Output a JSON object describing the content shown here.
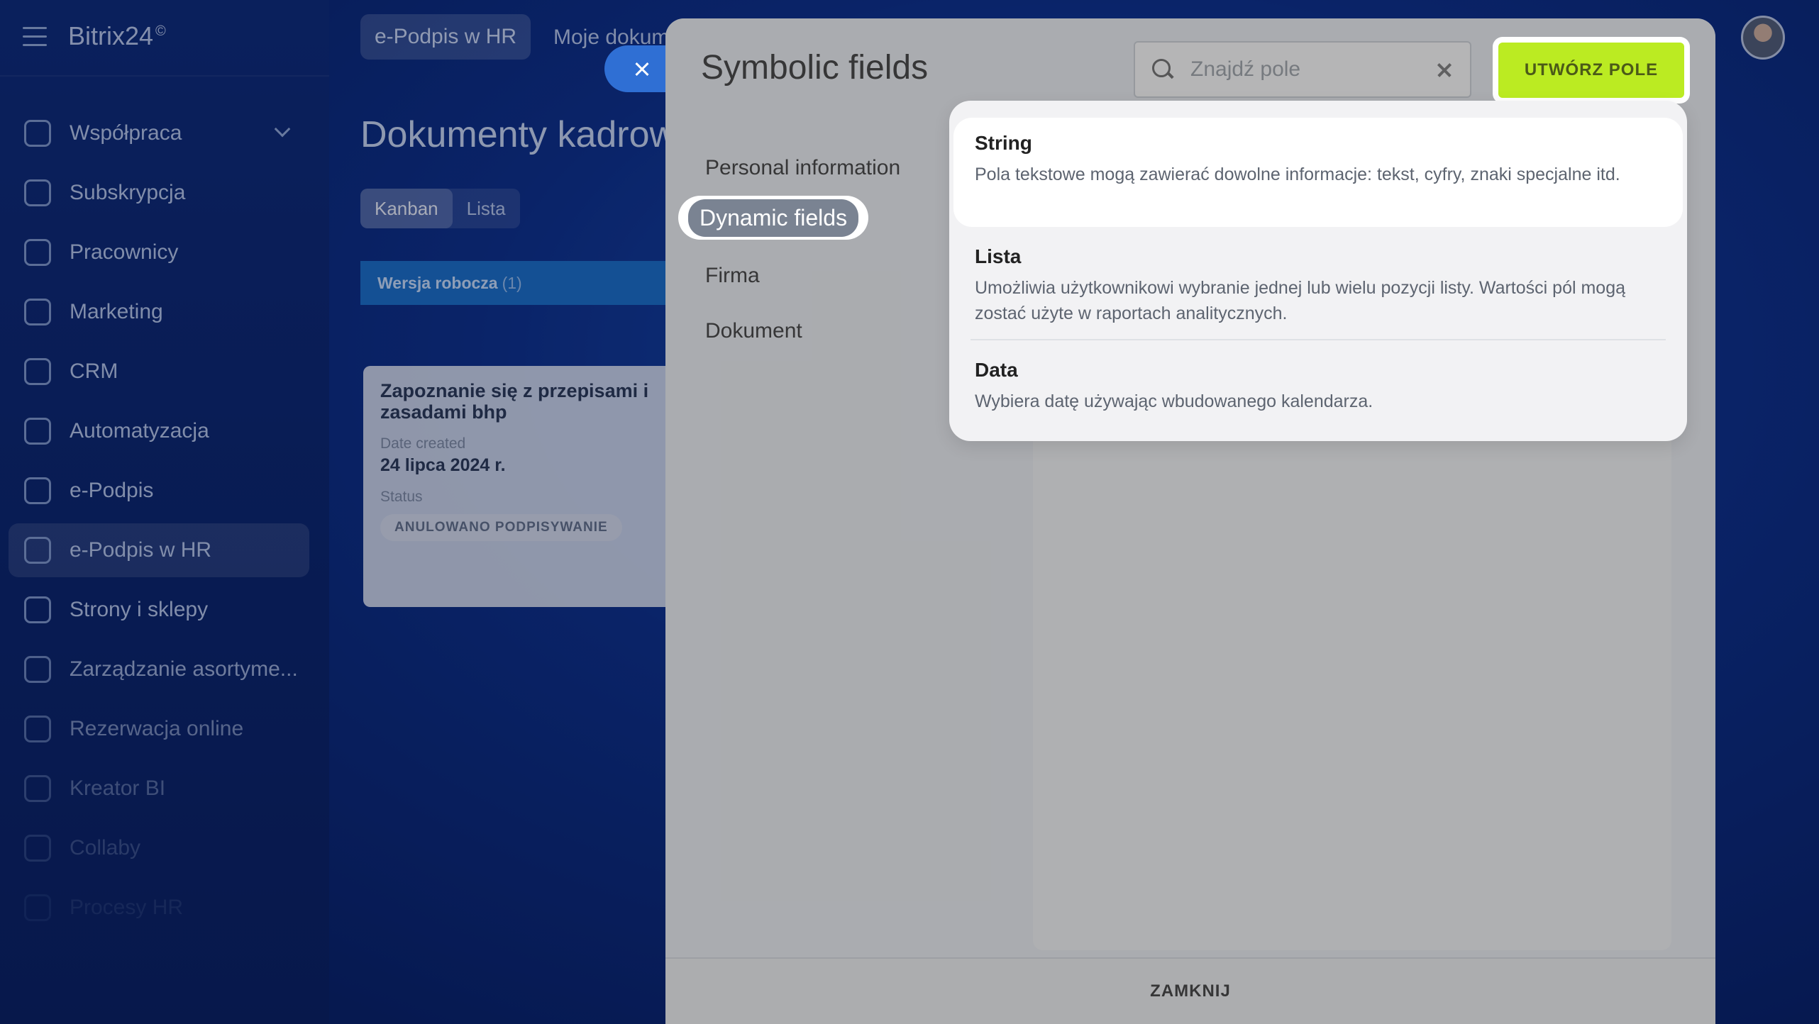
{
  "app": {
    "brand": "Bitrix24",
    "brand_mark": "©",
    "sidebar": {
      "items": [
        {
          "label": "Współpraca",
          "icon": "collab-icon",
          "has_chevron": true
        },
        {
          "label": "Subskrypcja",
          "icon": "subscription-icon"
        },
        {
          "label": "Pracownicy",
          "icon": "employees-icon"
        },
        {
          "label": "Marketing",
          "icon": "marketing-icon"
        },
        {
          "label": "CRM",
          "icon": "crm-icon"
        },
        {
          "label": "Automatyzacja",
          "icon": "automation-icon"
        },
        {
          "label": "e-Podpis",
          "icon": "signature-icon"
        },
        {
          "label": "e-Podpis w HR",
          "icon": "hr-signature-icon",
          "active": true
        },
        {
          "label": "Strony i sklepy",
          "icon": "cart-icon"
        },
        {
          "label": "Zarządzanie asortyme...",
          "icon": "warehouse-icon"
        },
        {
          "label": "Rezerwacja online",
          "icon": "calendar-icon"
        },
        {
          "label": "Kreator BI",
          "icon": "chart-icon"
        },
        {
          "label": "Collaby",
          "icon": "collaby-icon"
        },
        {
          "label": "Procesy HR",
          "icon": "hr-process-icon"
        }
      ]
    },
    "topbar": {
      "active_tab": "e-Podpis w HR",
      "link": "Moje dokum"
    },
    "page_title": "Dokumenty kadrowe",
    "view_toggle": [
      "Kanban",
      "Lista"
    ],
    "column": {
      "title": "Wersja robocza",
      "count": "(1)"
    },
    "card": {
      "title": "Zapoznanie się z przepisami i zasadami bhp",
      "date_label": "Date created",
      "date_value": "24 lipca 2024 r.",
      "status_label": "Status",
      "status_badge": "ANULOWANO PODPISYWANIE"
    }
  },
  "modal": {
    "title": "Symbolic fields",
    "search_placeholder": "Znajdź pole",
    "create_button": "UTWÓRZ POLE",
    "nav": [
      "Personal information",
      "Dynamic fields",
      "Firma",
      "Dokument"
    ],
    "active_nav": "Dynamic fields",
    "footer_button": "ZAMKNIJ",
    "dropdown": [
      {
        "title": "String",
        "desc": "Pola tekstowe mogą zawierać dowolne informacje: tekst, cyfry, znaki specjalne itd."
      },
      {
        "title": "Lista",
        "desc": "Umożliwia użytkownikowi wybranie jednej lub wielu pozycji listy. Wartości pól mogą zostać użyte w raportach analitycznych."
      },
      {
        "title": "Data",
        "desc": "Wybiera datę używając wbudowanego kalendarza."
      }
    ]
  },
  "colors": {
    "accent_green": "#bbeb22",
    "column_blue": "#1e73c9",
    "background_navy": "#0a1f5c"
  }
}
